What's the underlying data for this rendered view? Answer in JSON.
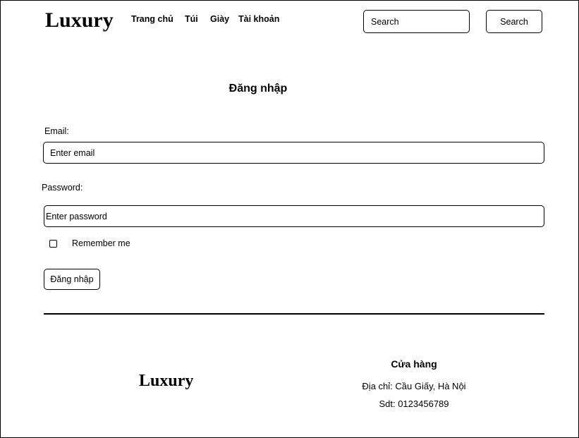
{
  "header": {
    "brand": "Luxury",
    "nav": [
      "Trang chủ",
      "Túi",
      "Giày",
      "Tài khoản"
    ],
    "search": {
      "placeholder": "Search",
      "button_label": "Search"
    }
  },
  "login": {
    "title": "Đăng nhập",
    "email_label": "Email:",
    "email_placeholder": "Enter email",
    "password_label": "Password:",
    "password_placeholder": "Enter password",
    "remember_label": "Remember me",
    "submit_label": "Đăng nhập"
  },
  "footer": {
    "brand": "Luxury",
    "store_title": "Cửa hàng",
    "address": "Địa chỉ: Cầu Giấy, Hà Nội",
    "phone": "Sdt: 0123456789"
  }
}
